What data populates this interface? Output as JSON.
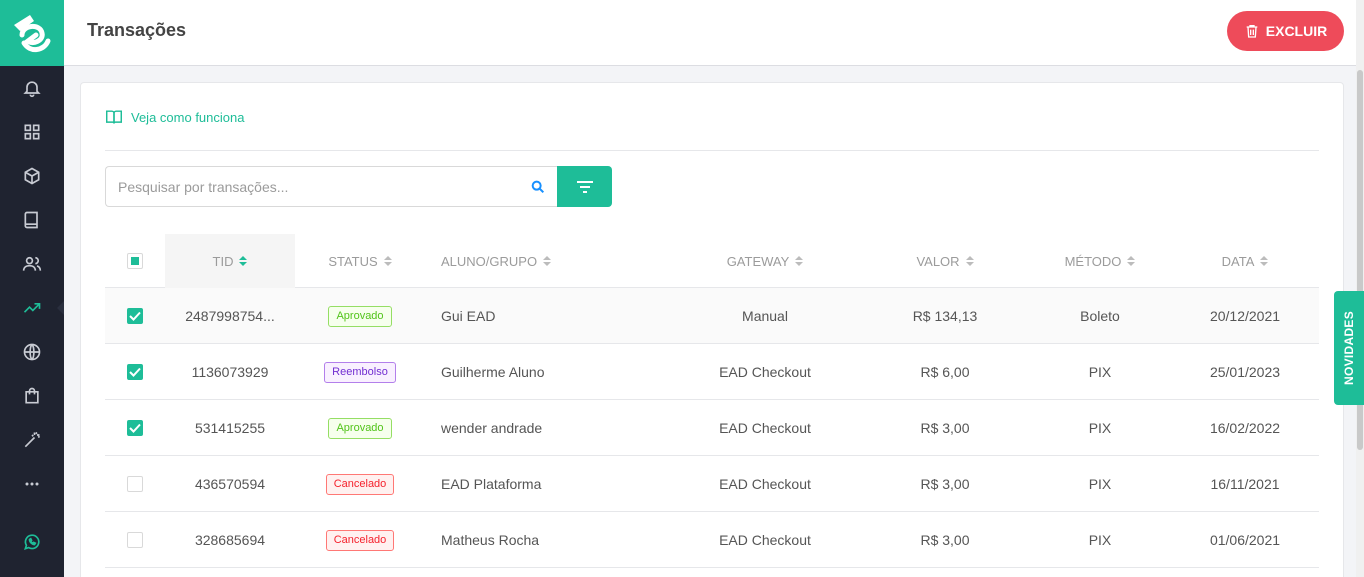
{
  "header": {
    "title": "Transações",
    "delete_label": "EXCLUIR"
  },
  "help": {
    "label": "Veja como funciona"
  },
  "search": {
    "placeholder": "Pesquisar por transações..."
  },
  "table": {
    "columns": [
      "TID",
      "STATUS",
      "ALUNO/GRUPO",
      "GATEWAY",
      "VALOR",
      "MÉTODO",
      "DATA"
    ],
    "rows": [
      {
        "tid": "2487998754...",
        "status": "Aprovado",
        "aluno": "Gui EAD",
        "gateway": "Manual",
        "valor": "R$ 134,13",
        "metodo": "Boleto",
        "data": "20/12/2021",
        "checked": true
      },
      {
        "tid": "1136073929",
        "status": "Reembolso",
        "aluno": "Guilherme Aluno",
        "gateway": "EAD Checkout",
        "valor": "R$ 6,00",
        "metodo": "PIX",
        "data": "25/01/2023",
        "checked": true
      },
      {
        "tid": "531415255",
        "status": "Aprovado",
        "aluno": "wender andrade",
        "gateway": "EAD Checkout",
        "valor": "R$ 3,00",
        "metodo": "PIX",
        "data": "16/02/2022",
        "checked": true
      },
      {
        "tid": "436570594",
        "status": "Cancelado",
        "aluno": "EAD Plataforma",
        "gateway": "EAD Checkout",
        "valor": "R$ 3,00",
        "metodo": "PIX",
        "data": "16/11/2021",
        "checked": false
      },
      {
        "tid": "328685694",
        "status": "Cancelado",
        "aluno": "Matheus Rocha",
        "gateway": "EAD Checkout",
        "valor": "R$ 3,00",
        "metodo": "PIX",
        "data": "01/06/2021",
        "checked": false
      }
    ]
  },
  "novidades": {
    "label": "NOVIDADES"
  },
  "sidebar": {
    "icons": [
      "bell-icon",
      "dashboard-grid-icon",
      "box-icon",
      "book-icon",
      "users-icon",
      "trending-up-icon",
      "globe-icon",
      "shopping-bag-icon",
      "magic-wand-icon",
      "more-dots-icon",
      "whatsapp-icon"
    ],
    "active": "trending-up-icon"
  },
  "colors": {
    "accent": "#1ebd98",
    "danger": "#ee4b5a",
    "sidebar": "#1f2330"
  }
}
